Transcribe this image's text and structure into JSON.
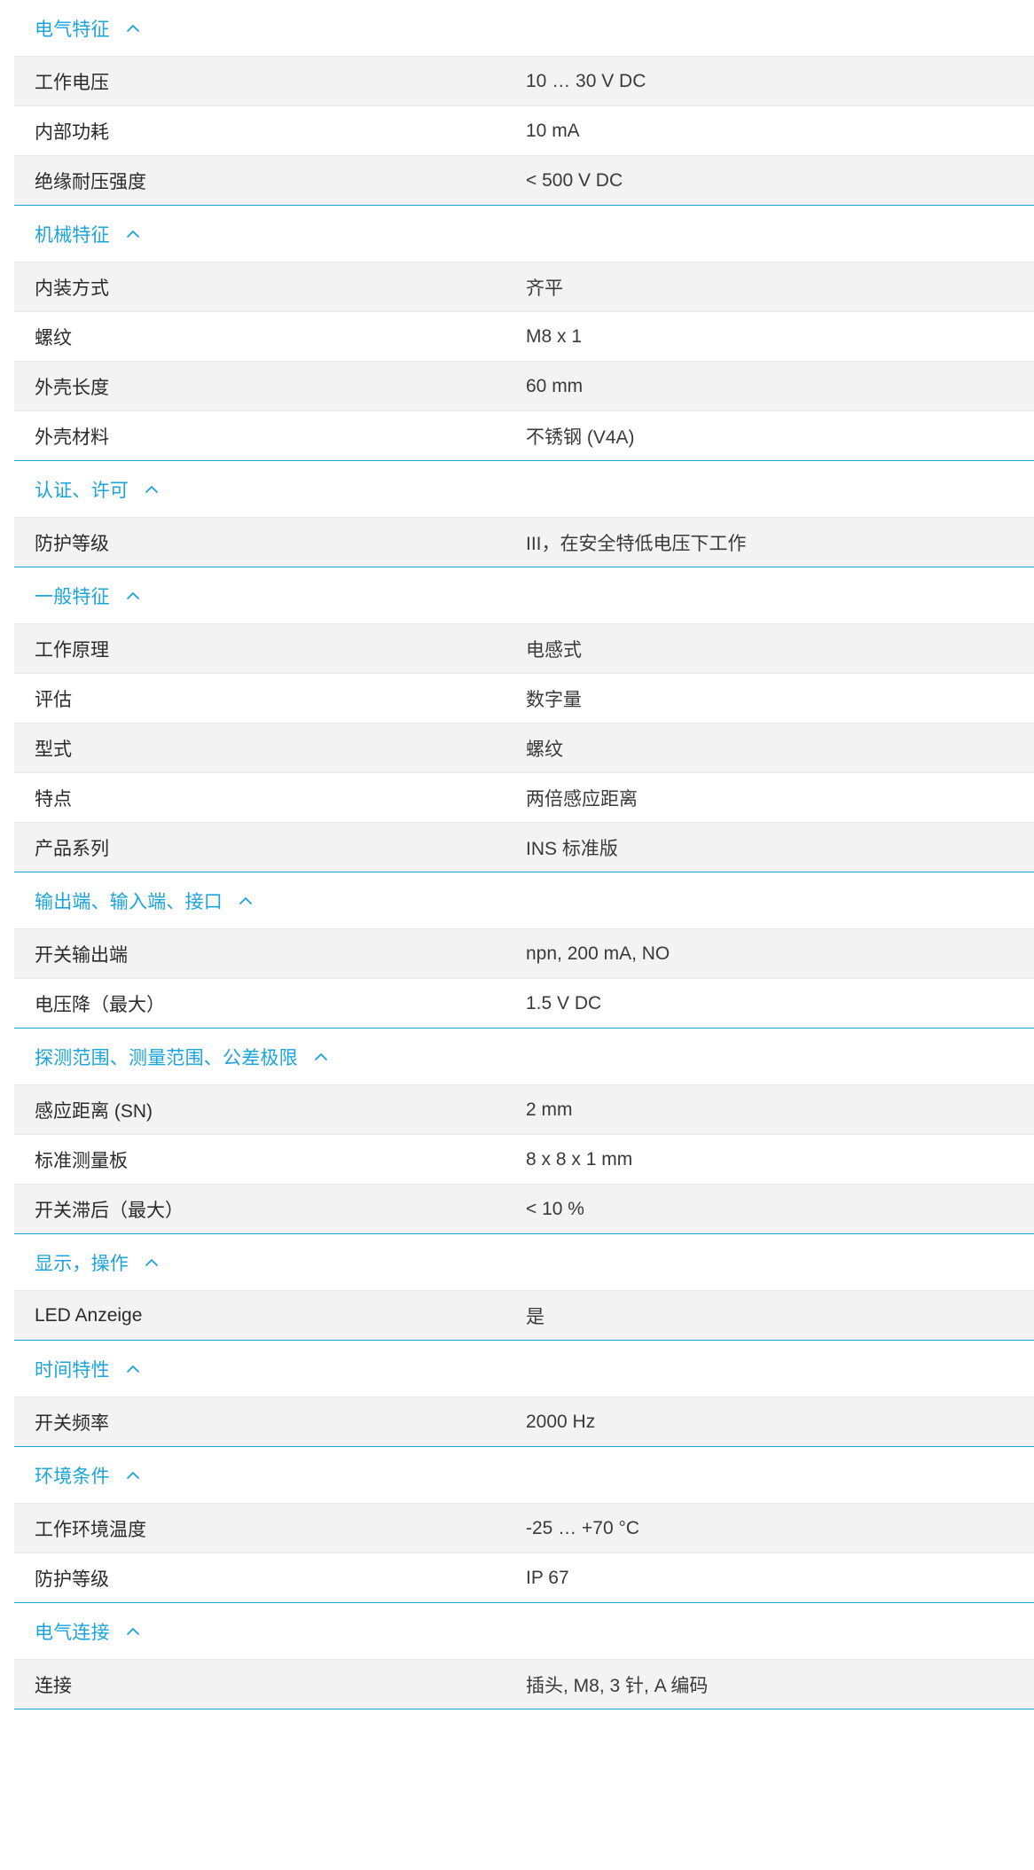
{
  "colors": {
    "accent": "#1ba4dc",
    "row_alt": "#f3f3f3",
    "text": "#2b2b2b"
  },
  "icons": {
    "section_toggle": "chevron-up-icon"
  },
  "sections": [
    {
      "title": "电气特征",
      "rows": [
        {
          "label": "工作电压",
          "value": "10 … 30 V DC"
        },
        {
          "label": "内部功耗",
          "value": "10 mA"
        },
        {
          "label": "绝缘耐压强度",
          "value": "< 500 V DC"
        }
      ]
    },
    {
      "title": "机械特征",
      "rows": [
        {
          "label": "内装方式",
          "value": "齐平"
        },
        {
          "label": "螺纹",
          "value": "M8 x 1"
        },
        {
          "label": "外壳长度",
          "value": "60 mm"
        },
        {
          "label": "外壳材料",
          "value": "不锈钢 (V4A)"
        }
      ]
    },
    {
      "title": "认证、许可",
      "rows": [
        {
          "label": "防护等级",
          "value": "III，在安全特低电压下工作"
        }
      ]
    },
    {
      "title": "一般特征",
      "rows": [
        {
          "label": "工作原理",
          "value": "电感式"
        },
        {
          "label": "评估",
          "value": "数字量"
        },
        {
          "label": "型式",
          "value": "螺纹"
        },
        {
          "label": "特点",
          "value": "两倍感应距离"
        },
        {
          "label": "产品系列",
          "value": "INS 标准版"
        }
      ]
    },
    {
      "title": "输出端、输入端、接口",
      "rows": [
        {
          "label": "开关输出端",
          "value": "npn, 200 mA, NO"
        },
        {
          "label": "电压降（最大）",
          "value": "1.5 V DC"
        }
      ]
    },
    {
      "title": "探测范围、测量范围、公差极限",
      "rows": [
        {
          "label": "感应距离 (SN)",
          "value": "2 mm"
        },
        {
          "label": "标准测量板",
          "value": "8 x 8 x 1 mm"
        },
        {
          "label": "开关滞后（最大）",
          "value": "< 10 %"
        }
      ]
    },
    {
      "title": "显示，操作",
      "rows": [
        {
          "label": "LED Anzeige",
          "value": "是"
        }
      ]
    },
    {
      "title": "时间特性",
      "rows": [
        {
          "label": "开关频率",
          "value": "2000 Hz"
        }
      ]
    },
    {
      "title": "环境条件",
      "rows": [
        {
          "label": "工作环境温度",
          "value": "-25 … +70 °C"
        },
        {
          "label": "防护等级",
          "value": "IP 67"
        }
      ]
    },
    {
      "title": "电气连接",
      "rows": [
        {
          "label": "连接",
          "value": "插头, M8, 3 针, A 编码"
        }
      ]
    }
  ]
}
